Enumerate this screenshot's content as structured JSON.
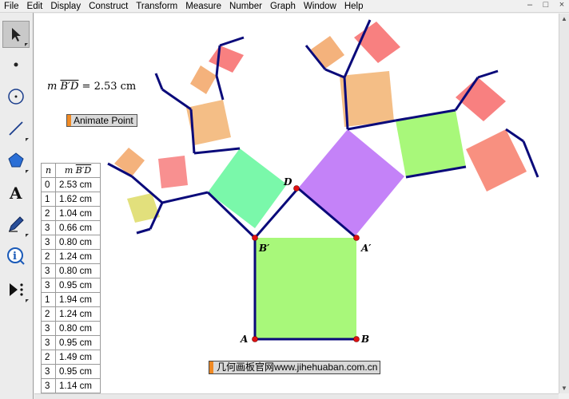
{
  "menu": {
    "items": [
      "File",
      "Edit",
      "Display",
      "Construct",
      "Transform",
      "Measure",
      "Number",
      "Graph",
      "Window",
      "Help"
    ],
    "window_controls": [
      "–",
      "□",
      "×"
    ]
  },
  "toolbox": {
    "tools": [
      "arrow-tool",
      "point-tool",
      "compass-tool",
      "straightedge-tool",
      "polygon-tool",
      "text-tool",
      "marker-tool",
      "information-tool",
      "custom-tool"
    ]
  },
  "measurement": {
    "prefix": "m",
    "segment": "B′D",
    "equals": " = 2.53 cm"
  },
  "animate_button": {
    "label": "Animate Point"
  },
  "table": {
    "col_n": "n",
    "col_m": "m",
    "col_seg": "B′D",
    "rows": [
      {
        "n": "0",
        "v": "2.53 cm"
      },
      {
        "n": "1",
        "v": "1.62 cm"
      },
      {
        "n": "2",
        "v": "1.04 cm"
      },
      {
        "n": "3",
        "v": "0.66 cm"
      },
      {
        "n": "3",
        "v": "0.80 cm"
      },
      {
        "n": "2",
        "v": "1.24 cm"
      },
      {
        "n": "3",
        "v": "0.80 cm"
      },
      {
        "n": "3",
        "v": "0.95 cm"
      },
      {
        "n": "1",
        "v": "1.94 cm"
      },
      {
        "n": "2",
        "v": "1.24 cm"
      },
      {
        "n": "3",
        "v": "0.80 cm"
      },
      {
        "n": "3",
        "v": "0.95 cm"
      },
      {
        "n": "2",
        "v": "1.49 cm"
      },
      {
        "n": "3",
        "v": "0.95 cm"
      },
      {
        "n": "3",
        "v": "1.14 cm"
      }
    ]
  },
  "points": {
    "A": "A",
    "B": "B",
    "A_prime": "A′",
    "B_prime": "B′",
    "D": "D"
  },
  "watermark": {
    "text": "几何画板官网www.jihehuaban.com.cn"
  },
  "colors": {
    "base_square": "#a8f87a",
    "left_square": "#7af8aa",
    "right_square": "#c482f8",
    "edge": "#0a0a7a",
    "point": "#e01010",
    "accent": "#f08a24"
  }
}
